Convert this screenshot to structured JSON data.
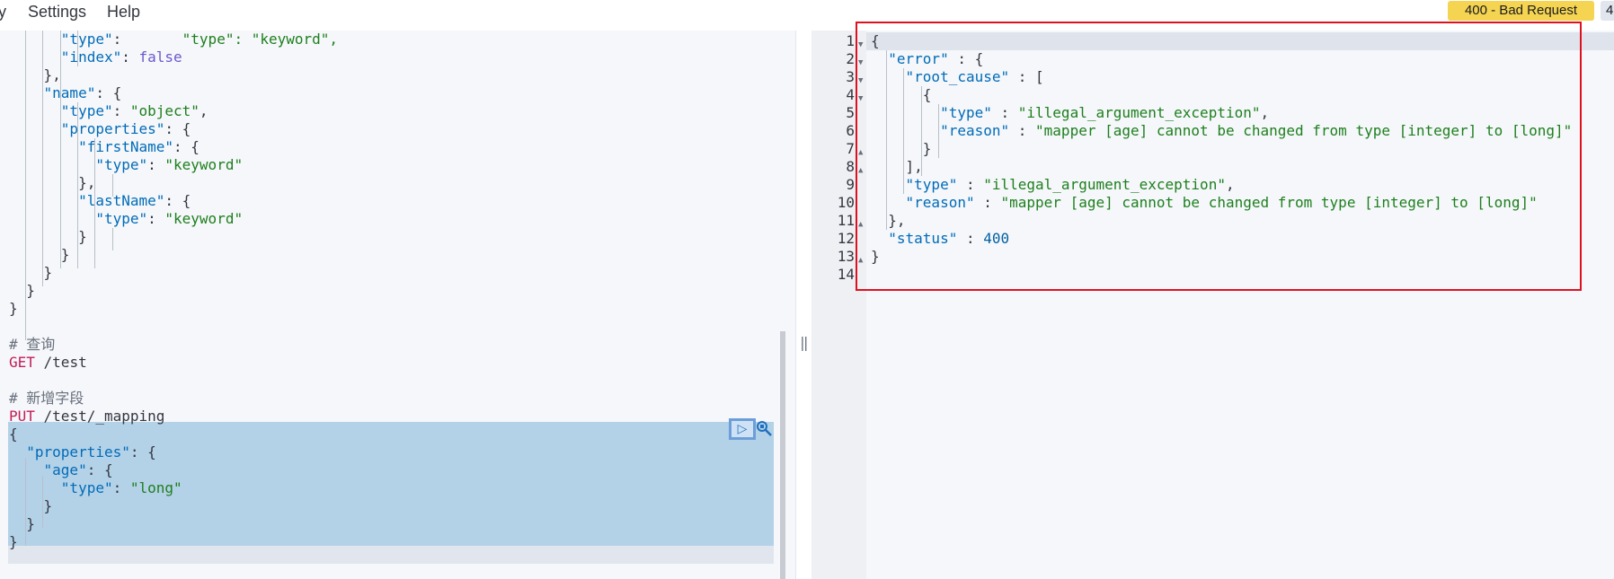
{
  "menu": {
    "items": [
      "y",
      "Settings",
      "Help"
    ]
  },
  "status": {
    "badge": "400 - Bad Request",
    "second_badge": "4"
  },
  "colors": {
    "status_badge": "#f5d451",
    "selection": "#b3d1e7",
    "annotation_box": "#e0111f"
  },
  "icons": {
    "run": "play-icon",
    "settings": "wrench-icon",
    "splitter": "resize-handle-icon"
  },
  "editor": {
    "lines": [
      "      \"type\": \"keyword\",",
      "      \"index\": false",
      "    },",
      "    \"name\": {",
      "      \"type\": \"object\",",
      "      \"properties\": {",
      "        \"firstName\": {",
      "          \"type\": \"keyword\"",
      "        },",
      "        \"lastName\": {",
      "          \"type\": \"keyword\"",
      "        }",
      "      }",
      "    }",
      "  }",
      "}",
      "",
      "# 查询",
      "GET /test",
      "",
      "# 新增字段",
      "PUT /test/_mapping",
      "{",
      "  \"properties\": {",
      "    \"age\": {",
      "      \"type\": \"long\"",
      "    }",
      "  }",
      "}"
    ]
  },
  "output": {
    "line_numbers": [
      "1",
      "2",
      "3",
      "4",
      "5",
      "6",
      "7",
      "8",
      "9",
      "10",
      "11",
      "12",
      "13",
      "14"
    ],
    "lines": [
      "{",
      "  \"error\" : {",
      "    \"root_cause\" : [",
      "      {",
      "        \"type\" : \"illegal_argument_exception\",",
      "        \"reason\" : \"mapper [age] cannot be changed from type [integer] to [long]\"",
      "      }",
      "    ],",
      "    \"type\" : \"illegal_argument_exception\",",
      "    \"reason\" : \"mapper [age] cannot be changed from type [integer] to [long]\"",
      "  },",
      "  \"status\" : 400",
      "}",
      ""
    ]
  }
}
